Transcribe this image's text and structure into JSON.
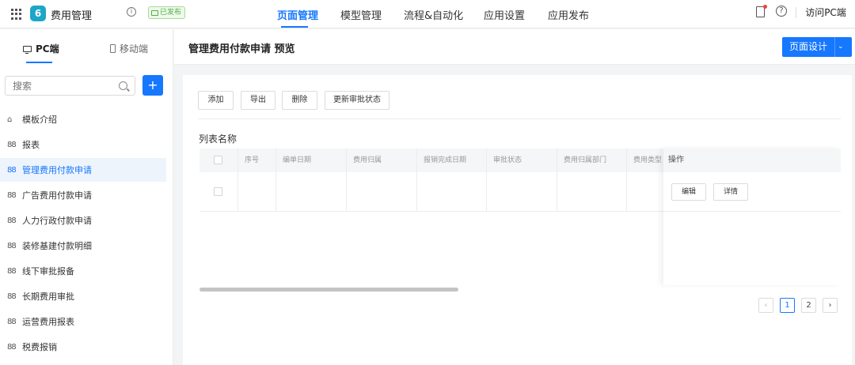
{
  "app": {
    "name": "费用管理",
    "logo_glyph": "6",
    "status_badge": "已发布",
    "info_glyph": "i"
  },
  "top_nav": {
    "tabs": [
      {
        "label": "页面管理",
        "active": true
      },
      {
        "label": "模型管理",
        "active": false
      },
      {
        "label": "流程&自动化",
        "active": false
      },
      {
        "label": "应用设置",
        "active": false
      },
      {
        "label": "应用发布",
        "active": false
      }
    ],
    "help_glyph": "?",
    "visit_pc_label": "访问PC端"
  },
  "sidebar": {
    "device_tabs": [
      {
        "label": "PC端",
        "active": true
      },
      {
        "label": "移动端",
        "active": false
      }
    ],
    "search_placeholder": "搜索",
    "add_glyph": "+",
    "items": [
      {
        "label": "模板介绍",
        "icon": "home-icon",
        "glyph": "⌂",
        "active": false
      },
      {
        "label": "报表",
        "icon": "report-icon",
        "glyph": "88",
        "active": false
      },
      {
        "label": "管理费用付款申请",
        "icon": "form-icon",
        "glyph": "88",
        "active": true
      },
      {
        "label": "广告费用付款申请",
        "icon": "form-icon",
        "glyph": "88",
        "active": false
      },
      {
        "label": "人力行政付款申请",
        "icon": "form-icon",
        "glyph": "88",
        "active": false
      },
      {
        "label": "装修基建付款明细",
        "icon": "form-icon",
        "glyph": "88",
        "active": false
      },
      {
        "label": "线下审批报备",
        "icon": "form-icon",
        "glyph": "88",
        "active": false
      },
      {
        "label": "长期费用审批",
        "icon": "form-icon",
        "glyph": "88",
        "active": false
      },
      {
        "label": "运营费用报表",
        "icon": "form-icon",
        "glyph": "88",
        "active": false
      },
      {
        "label": "税费报销",
        "icon": "form-icon",
        "glyph": "88",
        "active": false
      }
    ]
  },
  "main": {
    "title": "管理费用付款申请 预览",
    "design_button": "页面设计",
    "design_caret": "⌄",
    "toolbar": [
      "添加",
      "导出",
      "删除",
      "更新审批状态"
    ],
    "list_name": "列表名称",
    "table": {
      "columns": [
        "序号",
        "编单日期",
        "费用归属",
        "报销完成日期",
        "审批状态",
        "费用归属部门",
        "费用类型"
      ],
      "ops_header": "操作",
      "row_actions": [
        "编辑",
        "详情"
      ]
    },
    "pagination": {
      "prev": "‹",
      "pages": [
        "1",
        "2"
      ],
      "current_page": 1,
      "next": "›"
    }
  }
}
